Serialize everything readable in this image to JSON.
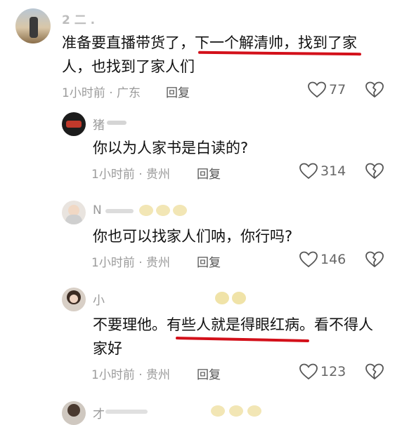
{
  "comments": [
    {
      "username": "2 二 .",
      "text_line1_a": "准备要直播带货了，",
      "text_line1_b": "下一个解清帅",
      "text_line1_c": "，",
      "text_line1_d": "找到了家",
      "text_line2": "人，也找到了家人们",
      "time": "1小时前",
      "sep": "·",
      "location": "广东",
      "reply": "回复",
      "likes": "77"
    },
    {
      "username": "猪",
      "text_line1": "你以为人家书是白读的?",
      "time": "1小时前",
      "sep": "·",
      "location": "贵州",
      "reply": "回复",
      "likes": "314"
    },
    {
      "username": "N",
      "text_line1": "你也可以找家人们呐，你行吗?",
      "time": "1小时前",
      "sep": "·",
      "location": "贵州",
      "reply": "回复",
      "likes": "146"
    },
    {
      "username": "小",
      "text_line1_a": "不要理他。",
      "text_line1_b": "有些人就是得眼红病",
      "text_line1_c": "。看不得人",
      "text_line2": "家好",
      "time": "1小时前",
      "sep": "·",
      "location": "贵州",
      "reply": "回复",
      "likes": "123"
    },
    {
      "username": "才"
    }
  ],
  "icons": {
    "like": "heart-icon",
    "dislike": "broken-heart-icon"
  },
  "colors": {
    "underline": "#d3101a",
    "meta": "#9b9b9b"
  }
}
